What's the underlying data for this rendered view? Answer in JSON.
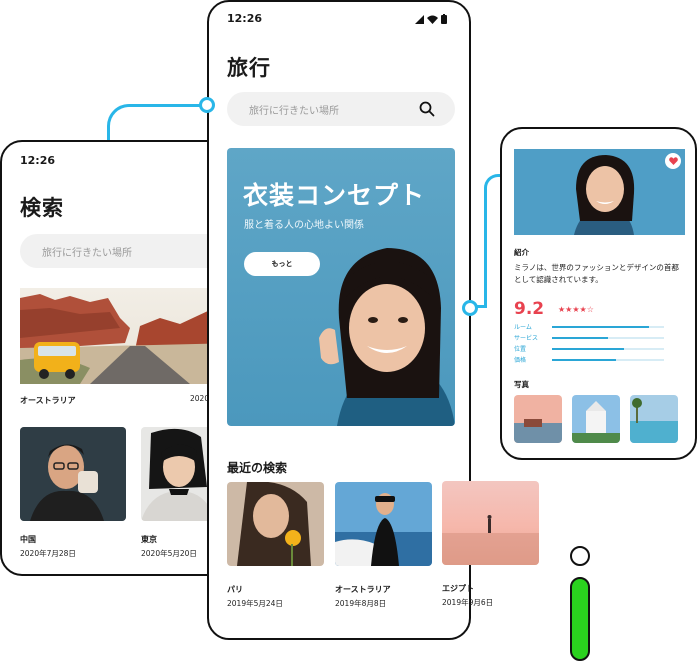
{
  "status": {
    "time": "12:26"
  },
  "center": {
    "title": "旅行",
    "search_placeholder": "旅行に行きたい場所",
    "banner": {
      "title": "衣装コンセプト",
      "subtitle": "服と着る人の心地よい関係",
      "button": "もっと"
    },
    "recent_title": "最近の検索",
    "recent": [
      {
        "name": "パリ",
        "date": "2019年5月24日"
      },
      {
        "name": "オーストラリア",
        "date": "2019年8月8日"
      },
      {
        "name": "エジプト",
        "date": "2019年9月6日"
      }
    ]
  },
  "left": {
    "title": "検索",
    "search_placeholder": "旅行に行きたい場所",
    "featured": {
      "name": "オーストラリア",
      "date": "2020"
    },
    "items": [
      {
        "name": "中国",
        "date": "2020年7月28日"
      },
      {
        "name": "東京",
        "date": "2020年5月20日"
      }
    ]
  },
  "right": {
    "intro_label": "紹介",
    "intro_text": "ミラノは、世界のファッションとデザインの首都として認識されています。",
    "score": "9.2",
    "stars": "★★★★☆",
    "ratings": [
      {
        "label": "ルーム",
        "value": 0.87
      },
      {
        "label": "サービス",
        "value": 0.5
      },
      {
        "label": "位置",
        "value": 0.64
      },
      {
        "label": "価格",
        "value": 0.57
      }
    ],
    "photos_label": "写真"
  },
  "colors": {
    "accent": "#29b6e8",
    "score_red": "#e8424f",
    "green": "#2ad11e"
  }
}
